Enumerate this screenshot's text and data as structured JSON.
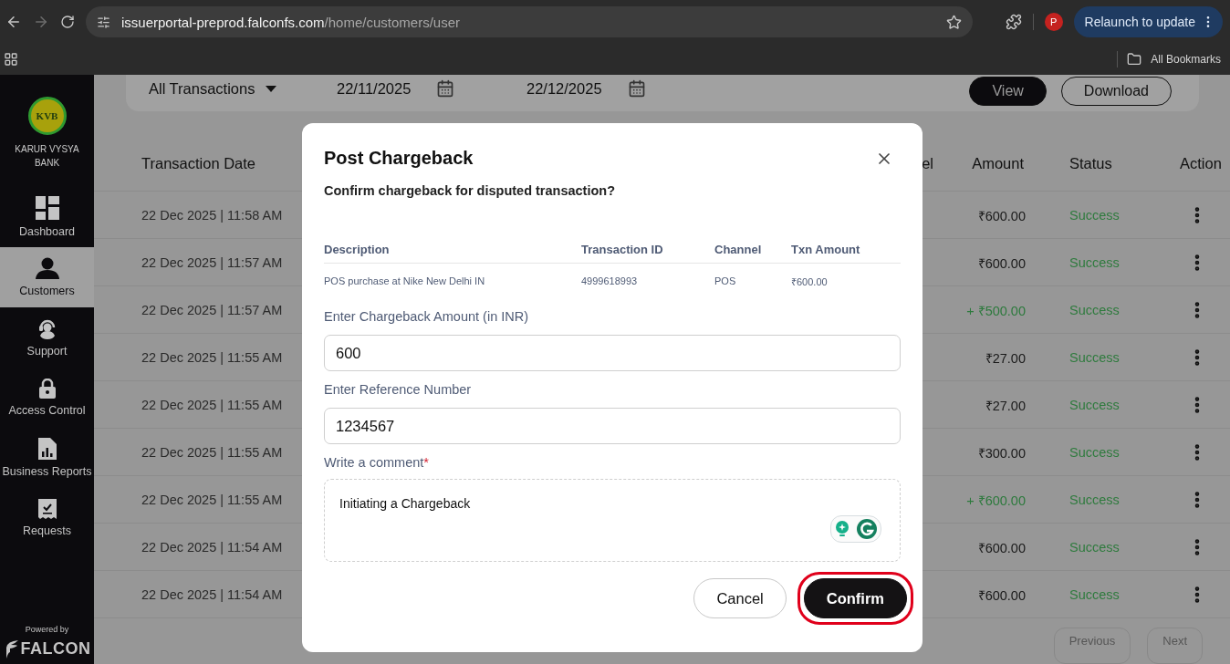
{
  "browser": {
    "url_host": "issuerportal-preprod.falconfs.com",
    "url_path": "/home/customers/user",
    "profile_initial": "P",
    "relaunch_label": "Relaunch to update",
    "bookmarks_label": "All Bookmarks"
  },
  "sidebar": {
    "logo_text": "KVB",
    "bank_name": "KARUR VYSYA BANK",
    "items": [
      {
        "label": "Dashboard",
        "selected": false
      },
      {
        "label": "Customers",
        "selected": true
      },
      {
        "label": "Support",
        "selected": false
      },
      {
        "label": "Access Control",
        "selected": false
      },
      {
        "label": "Business Reports",
        "selected": false
      },
      {
        "label": "Requests",
        "selected": false
      }
    ],
    "powered_by": "Powered by",
    "brand": "FALCON"
  },
  "filters": {
    "transaction_type": "All Transactions",
    "from_date": "22/11/2025",
    "to_date": "22/12/2025",
    "buttons": [
      {
        "label": "View",
        "kind": "primary"
      },
      {
        "label": "Download",
        "kind": "secondary"
      }
    ]
  },
  "table": {
    "columns": [
      "Transaction Date",
      "el",
      "Amount",
      "Status",
      "Action"
    ],
    "rows": [
      {
        "date": "22 Dec 2025 | 11:58 AM",
        "amount": "₹600.00",
        "kind": "debit",
        "status": "Success"
      },
      {
        "date": "22 Dec 2025 | 11:57 AM",
        "amount": "₹600.00",
        "kind": "debit",
        "status": "Success"
      },
      {
        "date": "22 Dec 2025 | 11:57 AM",
        "amount": "+ ₹500.00",
        "kind": "credit",
        "status": "Success"
      },
      {
        "date": "22 Dec 2025 | 11:55 AM",
        "amount": "₹27.00",
        "kind": "debit",
        "status": "Success"
      },
      {
        "date": "22 Dec 2025 | 11:55 AM",
        "amount": "₹27.00",
        "kind": "debit",
        "status": "Success"
      },
      {
        "date": "22 Dec 2025 | 11:55 AM",
        "amount": "₹300.00",
        "kind": "debit",
        "status": "Success"
      },
      {
        "date": "22 Dec 2025 | 11:55 AM",
        "amount": "+ ₹600.00",
        "kind": "credit",
        "status": "Success"
      },
      {
        "date": "22 Dec 2025 | 11:54 AM",
        "amount": "₹600.00",
        "kind": "debit",
        "status": "Success"
      },
      {
        "date": "22 Dec 2025 | 11:54 AM",
        "amount": "₹600.00",
        "kind": "debit",
        "status": "Success"
      }
    ]
  },
  "pagination": [
    "Previous",
    "Next"
  ],
  "modal": {
    "title": "Post Chargeback",
    "subtitle": "Confirm chargeback for disputed transaction?",
    "details": {
      "columns": [
        "Description",
        "Transaction ID",
        "Channel",
        "Txn Amount"
      ],
      "row": [
        "POS purchase at Nike New Delhi IN",
        "4999618993",
        "POS",
        "₹600.00"
      ]
    },
    "fields": [
      {
        "label": "Enter Chargeback Amount (in INR)",
        "value": "600"
      },
      {
        "label": "Enter Reference Number",
        "value": "1234567"
      }
    ],
    "comment": {
      "label": "Write a comment",
      "required_mark": "*",
      "value": "Initiating a Chargeback"
    },
    "buttons": [
      {
        "label": "Cancel",
        "kind": "secondary",
        "highlighted": false
      },
      {
        "label": "Confirm",
        "kind": "primary",
        "highlighted": true
      }
    ]
  }
}
